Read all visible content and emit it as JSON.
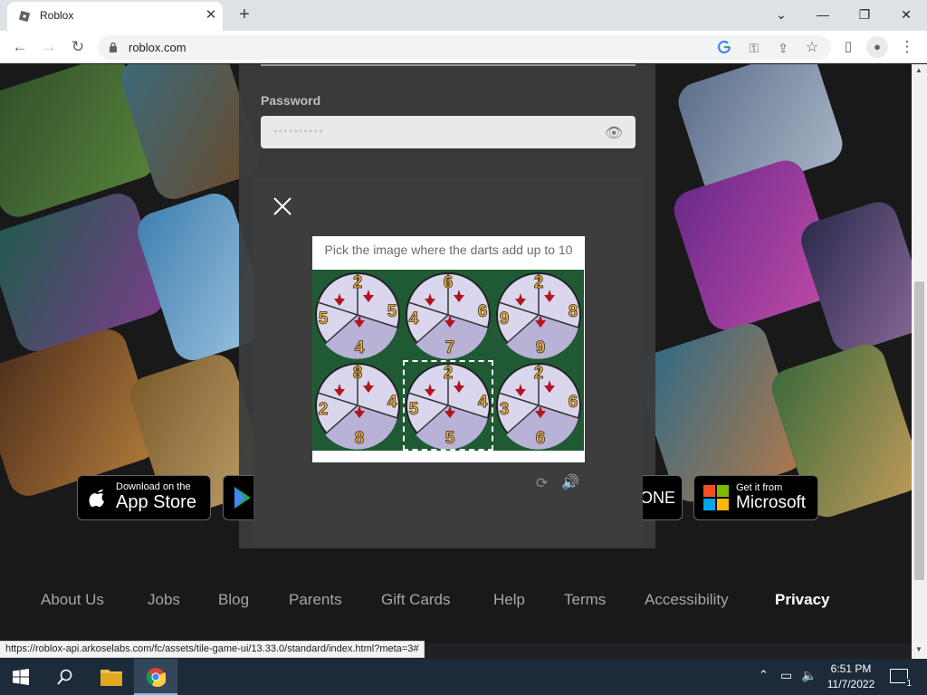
{
  "browser": {
    "tab_title": "Roblox",
    "url": "roblox.com",
    "tab_close": "✕",
    "new_tab": "+",
    "window_controls": [
      "⌄",
      "—",
      "❐",
      "✕"
    ]
  },
  "login": {
    "password_label": "Password",
    "password_dots": "••••••••••"
  },
  "stores": [
    {
      "small": "Download on the",
      "big": "App Store"
    },
    {
      "small": "",
      "big": ""
    },
    {
      "small": "",
      "big": "ONE"
    },
    {
      "small": "Get it from",
      "big": "Microsoft"
    }
  ],
  "footer_links": [
    "About Us",
    "Jobs",
    "Blog",
    "Parents",
    "Gift Cards",
    "Help",
    "Terms",
    "Accessibility",
    "Privacy"
  ],
  "captcha": {
    "instruction": "Pick the image where the darts add up to 10",
    "tiles": [
      {
        "numbers": [
          "2",
          "5",
          "5",
          "4"
        ]
      },
      {
        "numbers": [
          "6",
          "6",
          "4",
          "7"
        ]
      },
      {
        "numbers": [
          "2",
          "8",
          "9",
          "9"
        ]
      },
      {
        "numbers": [
          "8",
          "4",
          "2",
          "8"
        ]
      },
      {
        "numbers": [
          "2",
          "4",
          "5",
          "5"
        ]
      },
      {
        "numbers": [
          "2",
          "6",
          "3",
          "6"
        ]
      }
    ],
    "selected_tile": 5
  },
  "status_url": "https://roblox-api.arkoselabs.com/fc/assets/tile-game-ui/13.33.0/standard/index.html?meta=3#",
  "taskbar": {
    "time": "6:51 PM",
    "date": "11/7/2022",
    "notification_count": "1"
  },
  "colors": {
    "accent_google": "#4285f4",
    "modal_bg": "#3d3d3d",
    "tile_green": "#1f5a34",
    "dart_red": "#b1141e",
    "number_gold": "#f0b43c"
  },
  "icons": {
    "back": "←",
    "forward": "→",
    "reload": "↻",
    "key": "⚿",
    "share": "⇪",
    "star": "☆",
    "sidepanel": "▯",
    "profile": "●",
    "menu": "⋮",
    "eye": "👁",
    "captcha_reload": "⟳",
    "captcha_audio": "🔊",
    "start": "⊞",
    "search": "⚲",
    "folder": "▰",
    "chrome": "◉",
    "tray_up": "⌃",
    "network": "▭",
    "volume": "🔈",
    "notification": "▭",
    "scroll_up": "▲",
    "scroll_down": "▼"
  }
}
